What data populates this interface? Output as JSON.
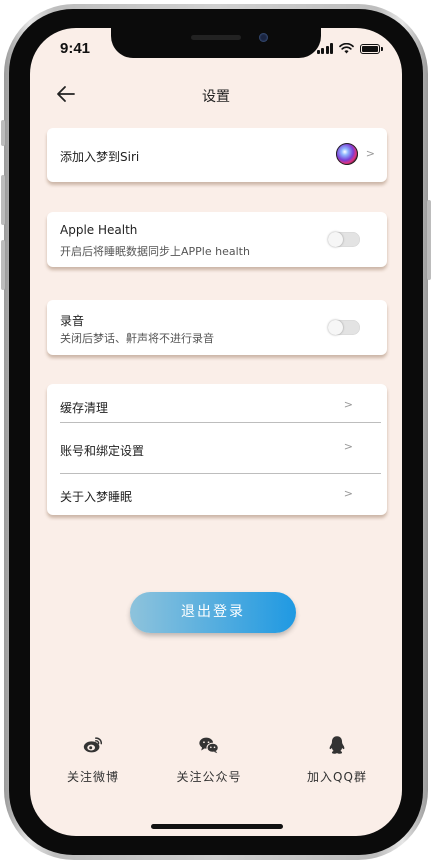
{
  "status_bar": {
    "time": "9:41"
  },
  "nav": {
    "back_icon": "arrow-left-icon",
    "title": "设置"
  },
  "siri_card": {
    "label": "添加入梦到Siri",
    "icon": "siri-icon",
    "chevron": ">"
  },
  "health_card": {
    "title": "Apple Health",
    "subtitle": "开启后将睡眠数据同步上APPle health",
    "toggle_on": false
  },
  "record_card": {
    "title": "录音",
    "subtitle": "关闭后梦话、鼾声将不进行录音",
    "toggle_on": false
  },
  "menu_card": {
    "items": [
      {
        "label": "缓存清理",
        "chevron": ">"
      },
      {
        "label": "账号和绑定设置",
        "chevron": ">"
      },
      {
        "label": "关于入梦睡眠",
        "chevron": ">"
      }
    ]
  },
  "logout": {
    "label": "退出登录",
    "gradient_start": "#8ec3dc",
    "gradient_end": "#1f99e2"
  },
  "footer": {
    "items": [
      {
        "label": "关注微博",
        "icon": "weibo-icon"
      },
      {
        "label": "关注公众号",
        "icon": "wechat-icon"
      },
      {
        "label": "加入QQ群",
        "icon": "qq-icon"
      }
    ]
  },
  "colors": {
    "background": "#faeee8",
    "card": "#ffffff",
    "accent": "#1f99e2"
  }
}
